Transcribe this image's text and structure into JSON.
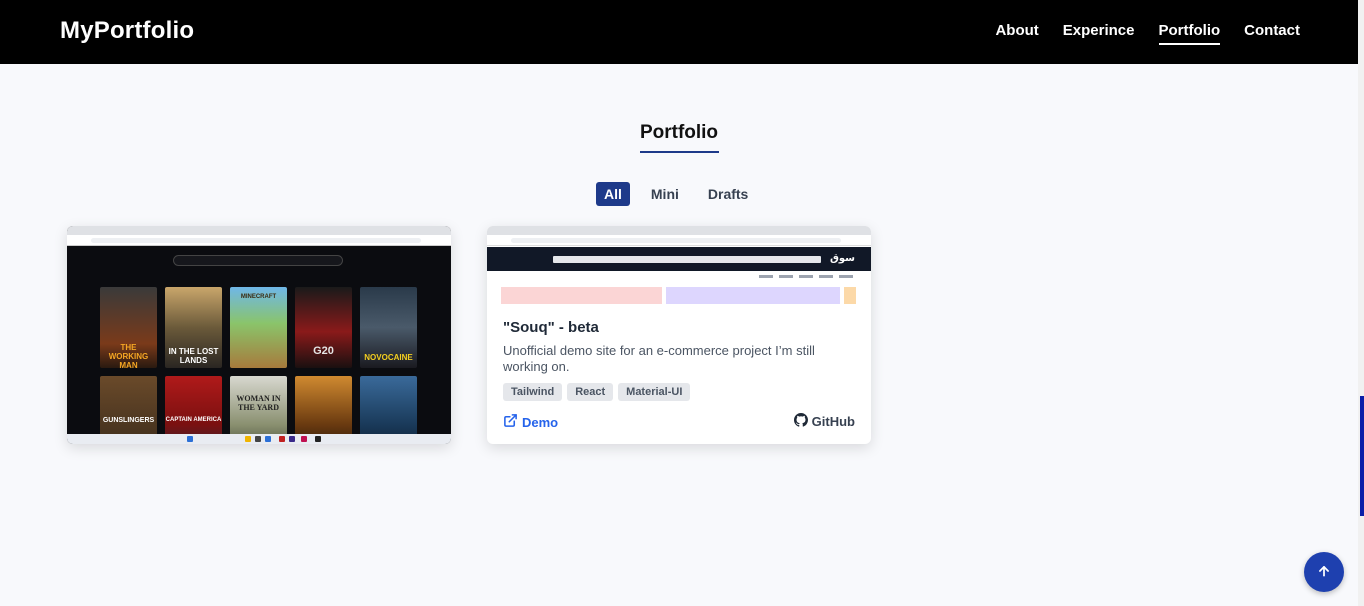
{
  "header": {
    "logo": "MyPortfolio",
    "nav": [
      {
        "label": "About"
      },
      {
        "label": "Experince"
      },
      {
        "label": "Portfolio"
      },
      {
        "label": "Contact"
      }
    ],
    "active_nav": "Portfolio"
  },
  "section": {
    "title": "Portfolio",
    "filters": [
      {
        "label": "All"
      },
      {
        "label": "Mini"
      },
      {
        "label": "Drafts"
      }
    ],
    "active_filter": "All"
  },
  "cards": [
    {
      "screenshot_posters": [
        "THE WORKING MAN",
        "IN THE LOST LANDS",
        "MINECRAFT",
        "G20",
        "NOVOCAINE",
        "GUNSLINGERS",
        "CAPTAIN AMERICA",
        "WOMAN IN THE YARD",
        "",
        ""
      ]
    },
    {
      "title": "\"Souq\" - beta",
      "description": "Unofficial demo site for an e-commerce project I’m still working on.",
      "tags": [
        "Tailwind",
        "React",
        "Material-UI"
      ],
      "demo_label": "Demo",
      "github_label": "GitHub",
      "screenshot_logo": "سوق"
    }
  ],
  "colors": {
    "header_bg": "#000000",
    "accent": "#1e3a8a",
    "link": "#2563eb",
    "page_bg": "#f8f9fc"
  },
  "icons": {
    "demo": "external-link-icon",
    "github": "github-icon",
    "to_top": "arrow-up-icon"
  }
}
